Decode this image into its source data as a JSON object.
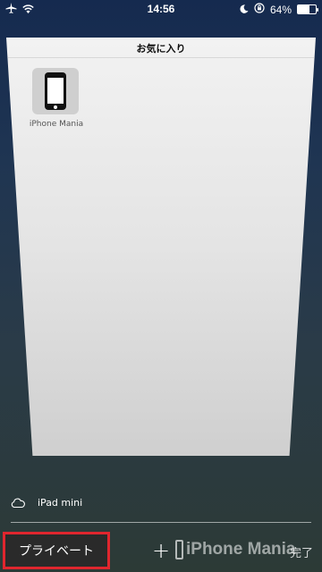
{
  "status_bar": {
    "time": "14:56",
    "battery_percent": "64%",
    "battery_level": 0.64,
    "icons": [
      "airplane-icon",
      "wifi-icon",
      "moon-icon",
      "orientation-lock-icon",
      "battery-icon"
    ]
  },
  "tab": {
    "title": "お気に入り",
    "favorite": {
      "label": "iPhone Mania",
      "icon": "iphone-icon"
    }
  },
  "device": {
    "name": "iPad mini",
    "icon": "cloud-icon"
  },
  "toolbar": {
    "private_label": "プライベート",
    "add_label": "+",
    "done_label": "完了"
  },
  "watermark": {
    "text": "iPhone Mania"
  },
  "colors": {
    "highlight": "#e0262e"
  }
}
